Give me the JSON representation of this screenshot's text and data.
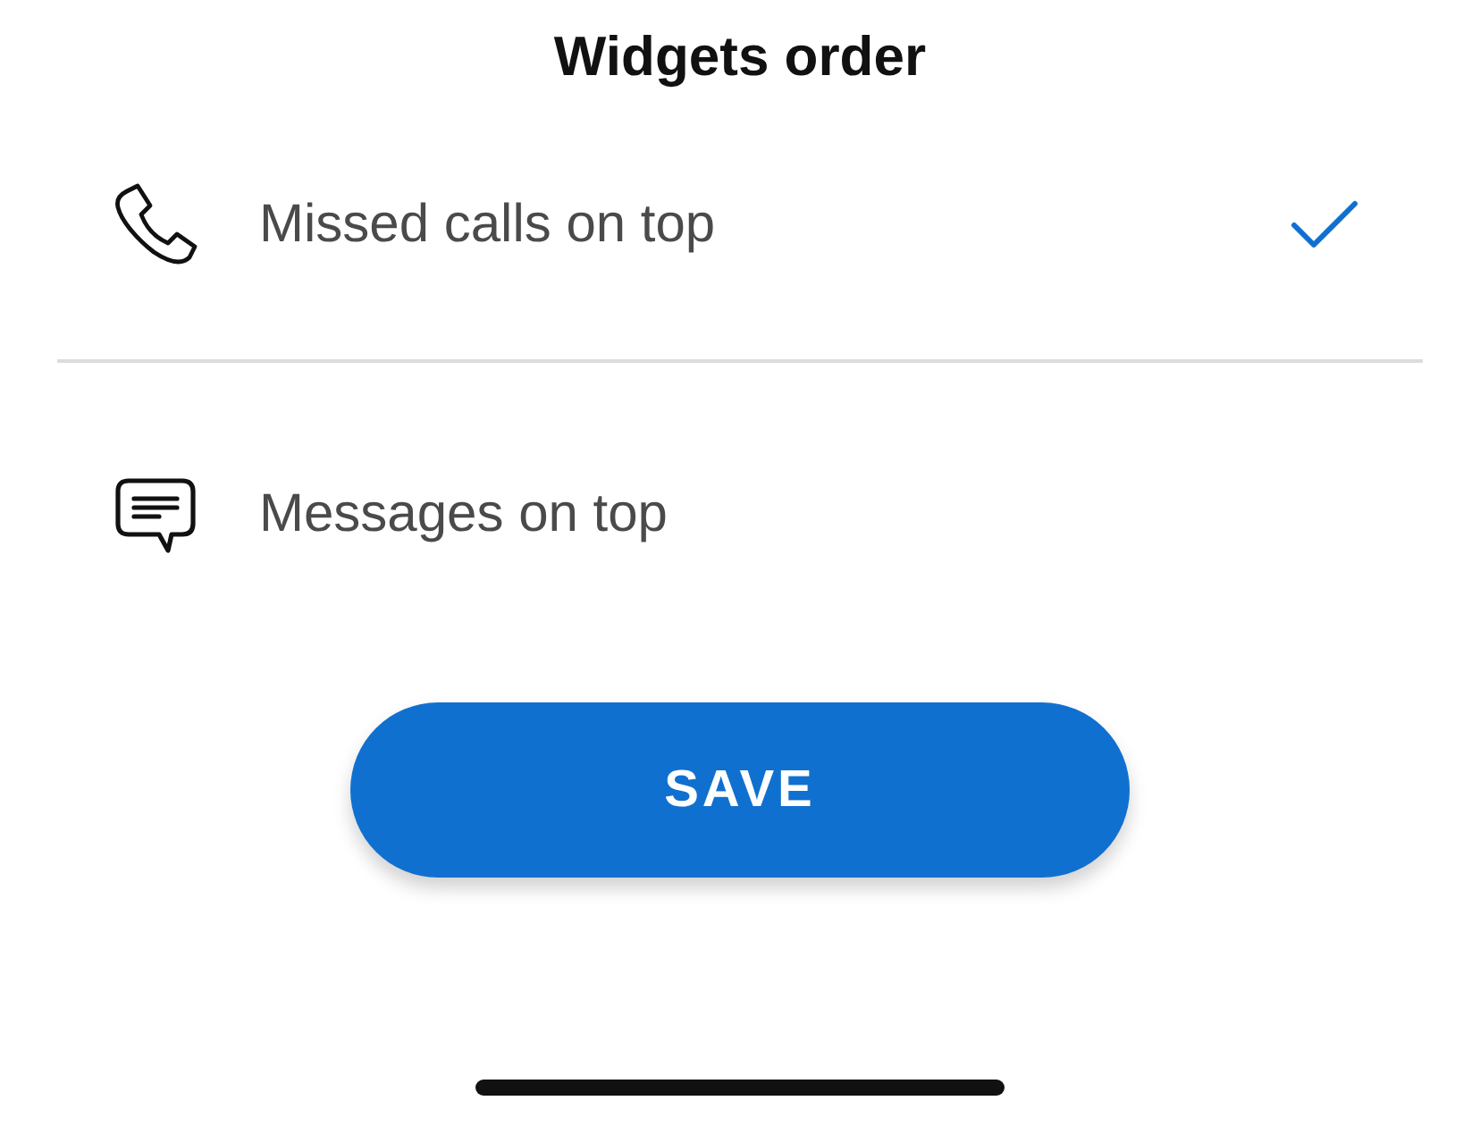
{
  "title": "Widgets order",
  "options": [
    {
      "kind": "phone",
      "label": "Missed calls on top",
      "selected": true
    },
    {
      "kind": "message",
      "label": "Messages on top",
      "selected": false
    }
  ],
  "button": {
    "label": "SAVE"
  }
}
